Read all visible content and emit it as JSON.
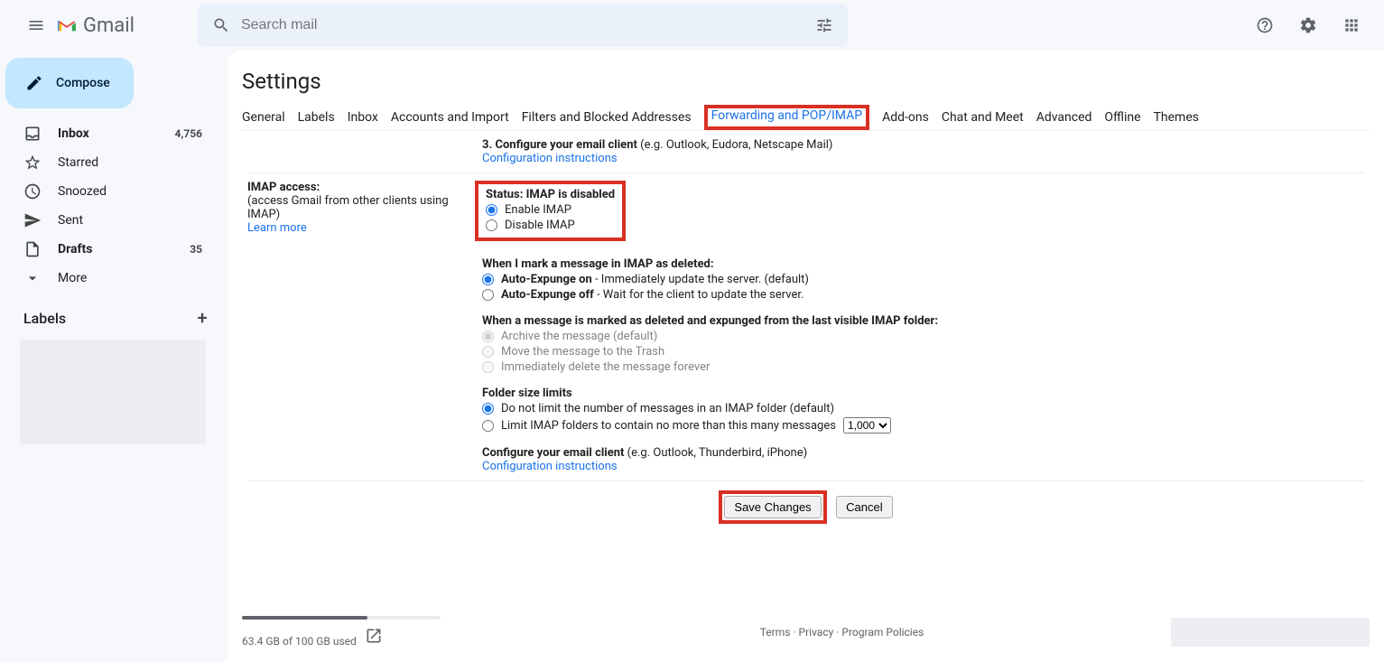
{
  "app": {
    "name": "Gmail",
    "searchPlaceholder": "Search mail"
  },
  "sidebar": {
    "compose": "Compose",
    "items": [
      {
        "label": "Inbox",
        "count": "4,756",
        "bold": true
      },
      {
        "label": "Starred",
        "count": ""
      },
      {
        "label": "Snoozed",
        "count": ""
      },
      {
        "label": "Sent",
        "count": ""
      },
      {
        "label": "Drafts",
        "count": "35",
        "bold": true
      },
      {
        "label": "More",
        "count": ""
      }
    ],
    "labelsHeader": "Labels"
  },
  "settings": {
    "title": "Settings",
    "tabs": [
      "General",
      "Labels",
      "Inbox",
      "Accounts and Import",
      "Filters and Blocked Addresses",
      "Forwarding and POP/IMAP",
      "Add-ons",
      "Chat and Meet",
      "Advanced",
      "Offline",
      "Themes"
    ],
    "activeTab": "Forwarding and POP/IMAP",
    "pop": {
      "step3": "3. Configure your email client",
      "step3extra": " (e.g. Outlook, Eudora, Netscape Mail)",
      "configLink": "Configuration instructions"
    },
    "imap": {
      "label": "IMAP access:",
      "desc": "(access Gmail from other clients using IMAP)",
      "learnMore": "Learn more",
      "status": "Status: IMAP is disabled",
      "enable": "Enable IMAP",
      "disable": "Disable IMAP",
      "deleteHeader": "When I mark a message in IMAP as deleted:",
      "autoExpungeOnPrefix": "Auto-Expunge on",
      "autoExpungeOnRest": " - Immediately update the server. (default)",
      "autoExpungeOffPrefix": "Auto-Expunge off",
      "autoExpungeOffRest": " - Wait for the client to update the server.",
      "expungeHeader": "When a message is marked as deleted and expunged from the last visible IMAP folder:",
      "archive": "Archive the message (default)",
      "trash": "Move the message to the Trash",
      "deleteForever": "Immediately delete the message forever",
      "folderHeader": "Folder size limits",
      "noLimit": "Do not limit the number of messages in an IMAP folder (default)",
      "limitPrefix": "Limit IMAP folders to contain no more than this many messages",
      "limitValue": "1,000",
      "configureHeader": "Configure your email client",
      "configureExtra": " (e.g. Outlook, Thunderbird, iPhone)",
      "configLink": "Configuration instructions"
    },
    "buttons": {
      "save": "Save Changes",
      "cancel": "Cancel"
    }
  },
  "footer": {
    "storage": "63.4 GB of 100 GB used",
    "links": {
      "terms": "Terms",
      "privacy": "Privacy",
      "policies": "Program Policies"
    }
  }
}
